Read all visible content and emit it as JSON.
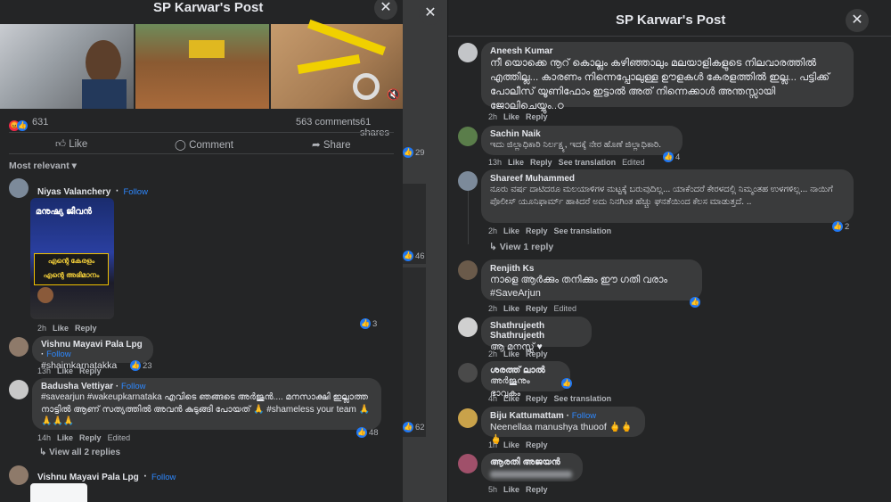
{
  "left": {
    "title": "SP Karwar's Post",
    "reaction_count": "631",
    "comments": "563 comments",
    "shares": "61 shares",
    "like_label": "Like",
    "comment_label": "Comment",
    "share_label": "Share",
    "sort_label": "Most relevant",
    "side_counts": [
      "29",
      "46",
      "62"
    ],
    "comment_list": [
      {
        "name": "Niyas Valanchery",
        "follow": "Follow",
        "poster_lines": [
          "മനുഷ്യ ജീവൻ",
          "എന്റെ കേരളം",
          "എന്റെ അഭിമാനം"
        ],
        "time": "2h",
        "likes": "3"
      },
      {
        "name": "Vishnu Mayavi Pala Lpg",
        "follow": "Follow",
        "text": "#shaimkarnatakka",
        "time": "13h",
        "likes": "23"
      },
      {
        "name": "Badusha Vettiyar",
        "follow": "Follow",
        "text": "#savearjun #wakeupkarnataka എവിടെ ഞങ്ങടെ അർജുൻ.... മനസാക്ഷി ഇല്ലാത്ത നാട്ടിൽ ആണ് സത്യത്തിൽ അവൻ കുടുങ്ങി പോയത് 🙏 #shameless your team 🙏🙏🙏🙏",
        "time": "14h",
        "edited": "Edited",
        "likes": "48"
      },
      {
        "name": "Vishnu Mayavi Pala Lpg",
        "follow": "Follow"
      }
    ],
    "view_replies": "View all 2 replies"
  },
  "right": {
    "title": "SP Karwar's Post",
    "comment_list": [
      {
        "name": "Aneesh Kumar",
        "text": "നീ യൊക്കെ നൂറ് കൊല്ലം കഴിഞ്ഞാലും മലയാളികളുടെ നിലവാരത്തിൽ എത്തില്ല... കാരണം നിന്നെപ്പോലുള്ള ഊളകൾ കേരളത്തിൽ ഇല്ല... പട്ടിക്ക് പോലീസ് യൂണിഫോം ഇട്ടാൽ അത് നിന്നെക്കാൾ അന്തസ്സായി ജോലിചെയ്യും..ഠ",
        "time": "2h"
      },
      {
        "name": "Sachin Naik",
        "text": "ಇದು ಜಿಲ್ಲಾಧಿಕಾರಿ ನಿರ್ಲಕ್ಷ್ಯ, ಇದಕ್ಕೆ ನೇರ ಹೊಣೆ ಜಿಲ್ಲಾಧಿಕಾರಿ.",
        "time": "13h",
        "translation": "See translation",
        "edited": "Edited",
        "likes": "4"
      },
      {
        "name": "Shareef Muhammed",
        "text": "ನೂರು ವರ್ಷ ದಾಟಿದರೂ ಮಲಯಾಳಿಗಳ ಮಟ್ಟಕ್ಕೆ ಬರುವುದಿಲ್ಲ... ಯಾಕೆಂದರೆ ಕೇರಳದಲ್ಲಿ ನಿಮ್ಮಂತಹ ಉಳಗಳಿಲ್ಲ... ನಾಯಿಗೆ ಪೊಲೀಸ್ ಯೂನಿಫಾರ್ಮ್ ಹಾಕಿದರೆ ಅದು ನಿನಗಿಂತ ಹೆಚ್ಚು ಘನತೆಯಿಂದ ಕೆಲಸ ಮಾಡುತ್ತದೆ. ..",
        "time": "2h",
        "translation": "See translation",
        "likes": "2",
        "view_reply": "View 1 reply"
      },
      {
        "name": "Renjith Ks",
        "text": "നാളെ ആർക്കും തനിക്കും ഈ ഗതി വരാം #SaveArjun",
        "time": "2h",
        "edited": "Edited"
      },
      {
        "name": "Shathrujeeth Shathrujeeth",
        "text": "ആ മനസ്സ് ♥",
        "time": "2h"
      },
      {
        "name": "ശരത്ത് ലാൽ",
        "text": "അർജുനും ഭാവുകം",
        "time": "4h",
        "translation": "See translation"
      },
      {
        "name": "Biju Kattumattam",
        "follow": "Follow",
        "text": "Neenellaa manushya thuoof 🖕🖕🖕",
        "time": "1h"
      },
      {
        "name": "ആരതി അജയൻ",
        "text": "",
        "time": "5h"
      }
    ],
    "like_label": "Like",
    "reply_label": "Reply"
  },
  "colors": {
    "bg": "#242526",
    "bubble": "#3a3b3c",
    "accent": "#2d88ff",
    "like": "#2078f4"
  }
}
